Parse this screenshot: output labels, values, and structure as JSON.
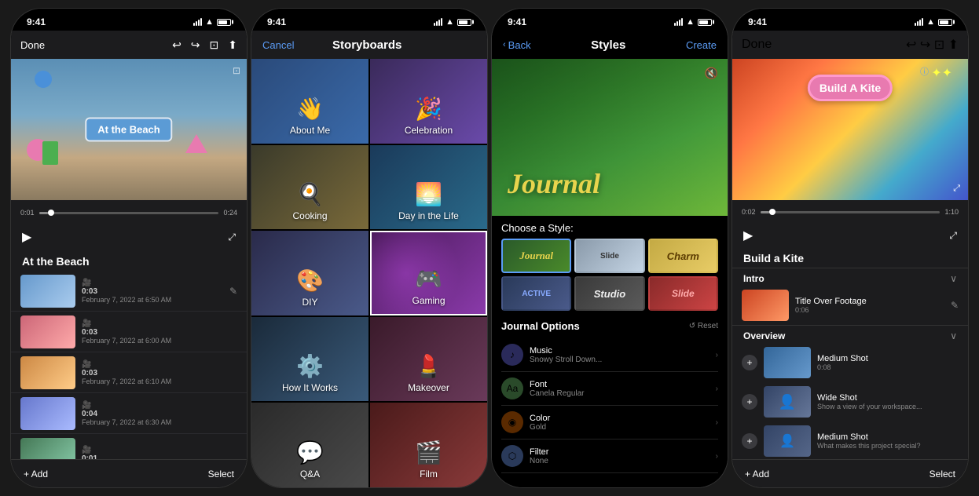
{
  "screens": [
    {
      "id": "screen1",
      "status": {
        "time": "9:41"
      },
      "nav": {
        "done": "Done"
      },
      "preview": {
        "title": "At the Beach"
      },
      "timeline": {
        "start": "0:01",
        "end": "0:24"
      },
      "project_title": "At the Beach",
      "clips": [
        {
          "duration": "0:03",
          "date": "February 7, 2022 at 6:50 AM",
          "bg": "clip-thumb-1"
        },
        {
          "duration": "0:03",
          "date": "February 7, 2022 at 6:00 AM",
          "bg": "clip-thumb-2"
        },
        {
          "duration": "0:03",
          "date": "February 7, 2022 at 6:10 AM",
          "bg": "clip-thumb-3"
        },
        {
          "duration": "0:04",
          "date": "February 7, 2022 at 6:30 AM",
          "bg": "clip-thumb-4"
        },
        {
          "duration": "0:01",
          "date": "",
          "bg": "clip-thumb-5"
        }
      ],
      "add_label": "+ Add",
      "select_label": "Select"
    },
    {
      "id": "screen2",
      "status": {
        "time": "9:41"
      },
      "nav": {
        "cancel": "Cancel",
        "title": "Storyboards"
      },
      "items": [
        {
          "label": "About Me",
          "icon": "👋",
          "bg": "sb-bg-aboutme"
        },
        {
          "label": "Celebration",
          "icon": "🎉",
          "bg": "sb-bg-celebration"
        },
        {
          "label": "Cooking",
          "icon": "🍳",
          "bg": "sb-bg-cooking"
        },
        {
          "label": "Day in the Life",
          "icon": "🌅",
          "bg": "sb-bg-dayinlife"
        },
        {
          "label": "DIY",
          "icon": "🎨",
          "bg": "sb-bg-diy"
        },
        {
          "label": "Gaming",
          "icon": "🎮",
          "bg": "sb-bg-gaming",
          "selected": true
        },
        {
          "label": "How It Works",
          "icon": "⚙️",
          "bg": "sb-bg-howitworks"
        },
        {
          "label": "Makeover",
          "icon": "💄",
          "bg": "sb-bg-makeover"
        },
        {
          "label": "Q&A",
          "icon": "💬",
          "bg": "sb-bg-qa"
        },
        {
          "label": "Film",
          "icon": "🎬",
          "bg": "sb-bg-film"
        }
      ]
    },
    {
      "id": "screen3",
      "status": {
        "time": "9:41"
      },
      "nav": {
        "back": "Back",
        "title": "Styles",
        "create": "Create"
      },
      "preview_title": "Journal",
      "choose_label": "Choose a Style:",
      "styles": [
        {
          "label": "Journal",
          "class": "st-journal",
          "selected": true
        },
        {
          "label": "Slide",
          "class": "st-slide"
        },
        {
          "label": "Charm",
          "class": "st-charm"
        },
        {
          "label": "Active",
          "class": "st-active"
        },
        {
          "label": "Studio",
          "class": "st-studio"
        },
        {
          "label": "Slide",
          "class": "st-slideb"
        }
      ],
      "options_title": "Journal Options",
      "reset_label": "↺ Reset",
      "options": [
        {
          "icon": "♪",
          "name": "Music",
          "value": "Snowy Stroll Down...",
          "icon_bg": "music-icon"
        },
        {
          "icon": "Aa",
          "name": "Font",
          "value": "Canela Regular",
          "icon_bg": "font-icon"
        },
        {
          "icon": "◉",
          "name": "Color",
          "value": "Gold",
          "icon_bg": "color-icon"
        },
        {
          "icon": "⬡",
          "name": "Filter",
          "value": "None",
          "icon_bg": "filter-icon"
        }
      ]
    },
    {
      "id": "screen4",
      "status": {
        "time": "9:41"
      },
      "nav": {
        "done": "Done"
      },
      "preview_title": "Build A Kite",
      "timeline": {
        "start": "0:02",
        "end": "1:10"
      },
      "project_title": "Build a Kite",
      "sections": [
        {
          "title": "Intro",
          "clips": [
            {
              "name": "Title Over Footage",
              "duration": "0:06",
              "bg": "clip-thumb4-1",
              "has_edit": true
            }
          ]
        },
        {
          "title": "Overview",
          "clips": [
            {
              "name": "Medium Shot",
              "desc": "0:08",
              "bg": "clip-thumb4-2"
            },
            {
              "name": "Wide Shot",
              "desc": "Show a view of your workspace...",
              "bg": "clip-thumb4-3"
            },
            {
              "name": "Medium Shot",
              "desc": "What makes this project special?",
              "bg": "clip-thumb4-3"
            }
          ]
        }
      ],
      "add_label": "+ Add",
      "select_label": "Select"
    }
  ]
}
